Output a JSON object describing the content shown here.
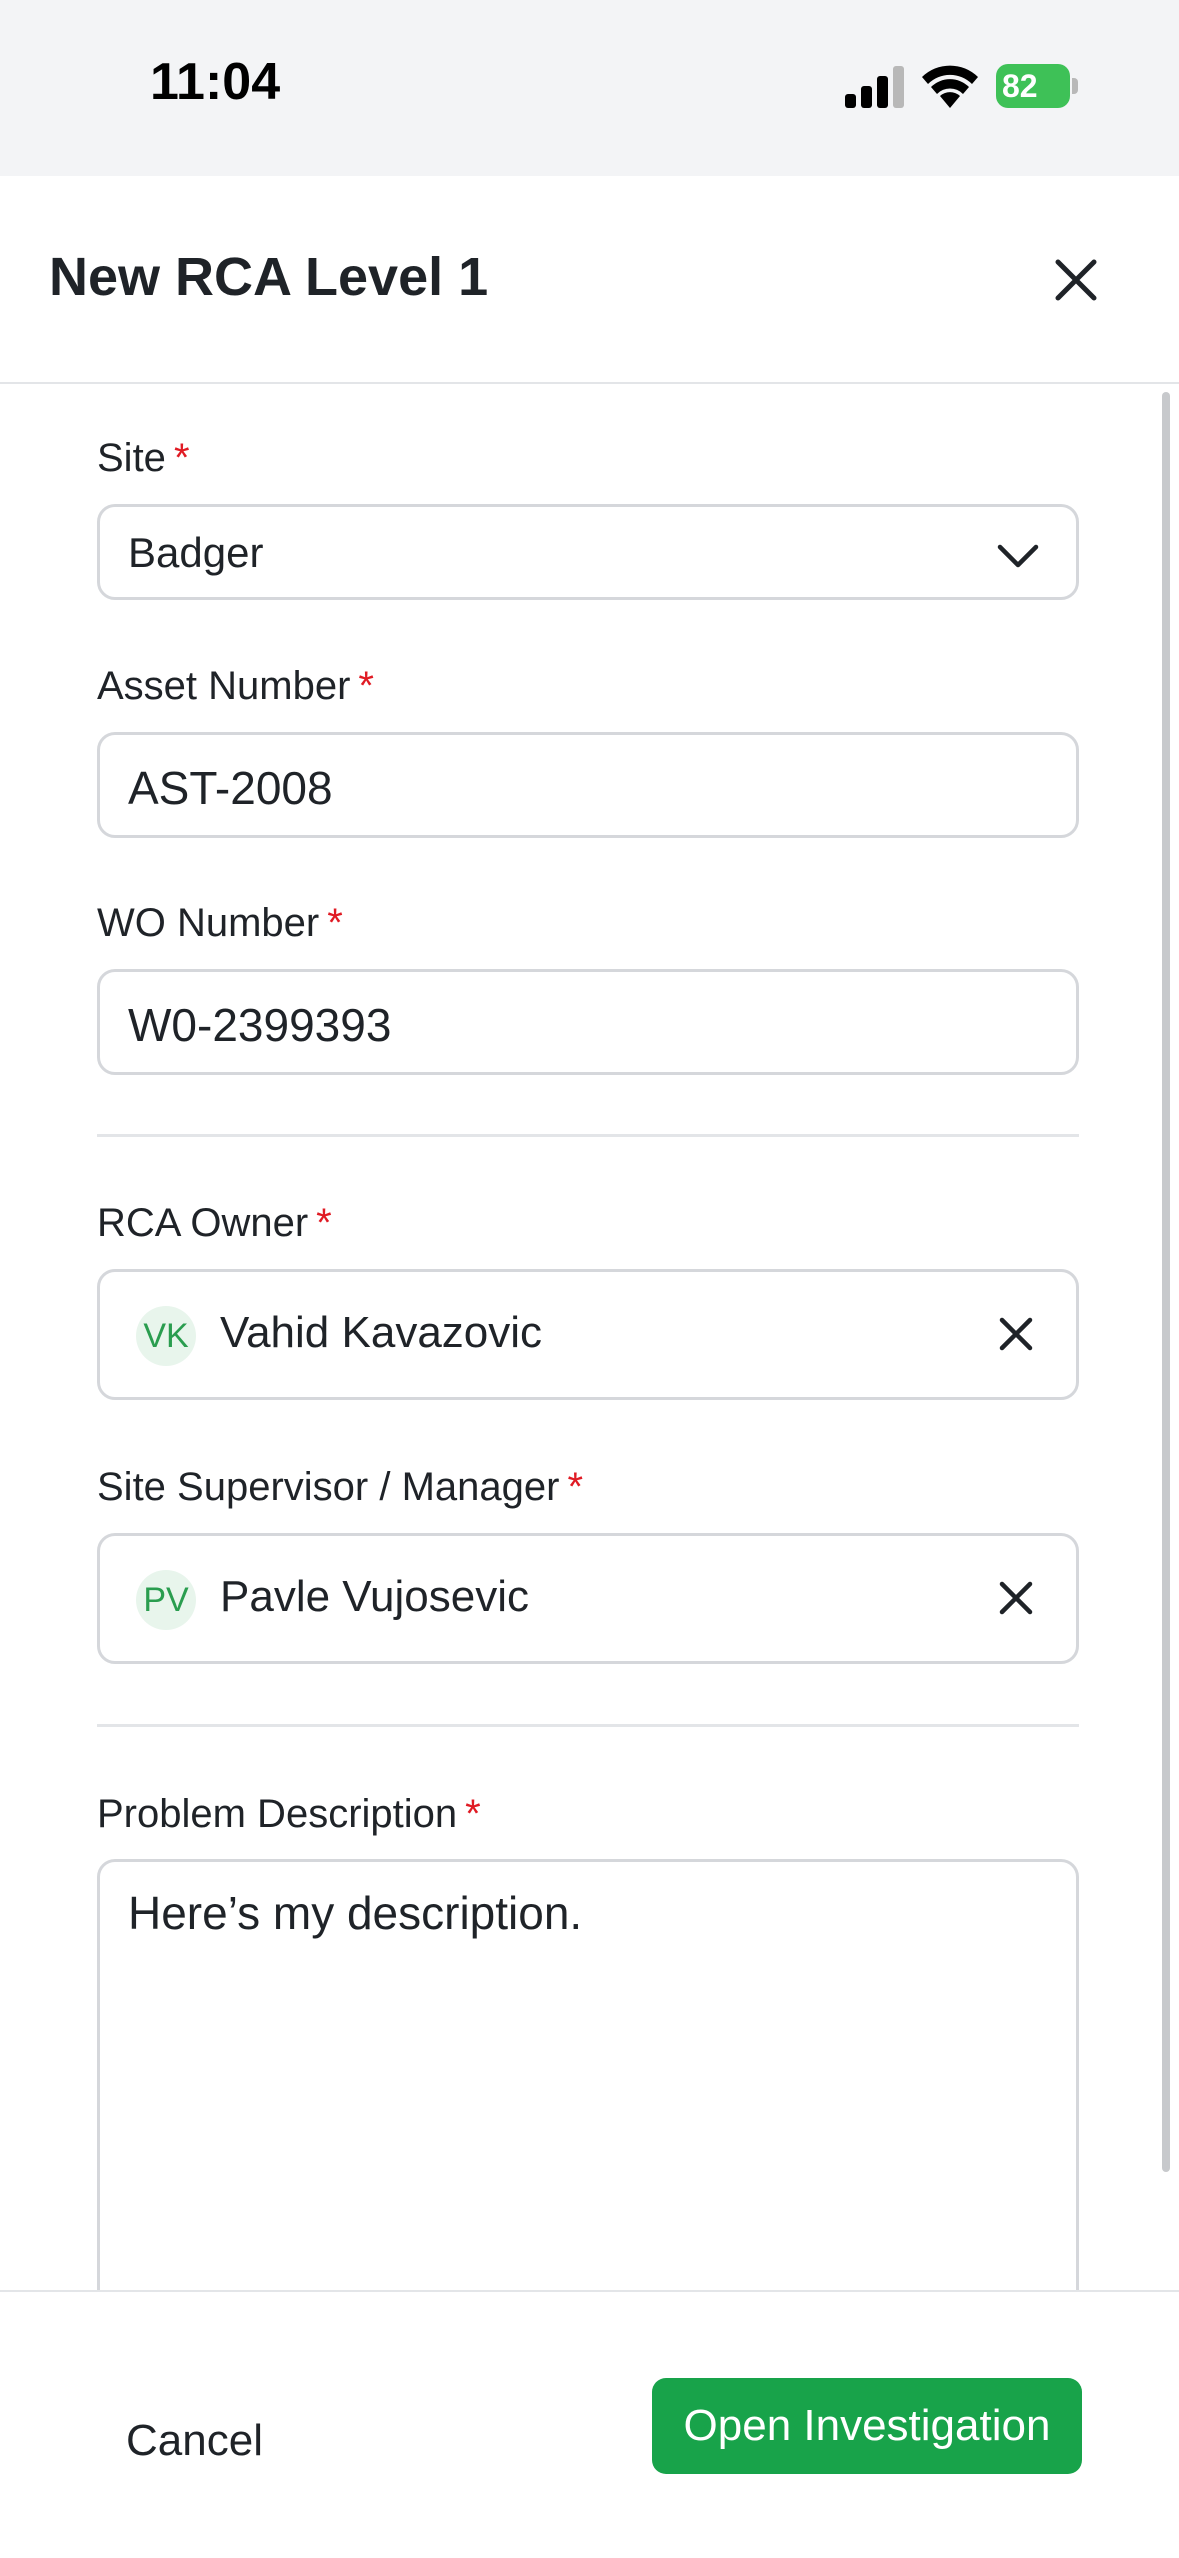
{
  "status_bar": {
    "time": "11:04",
    "battery": "82"
  },
  "header": {
    "title": "New RCA Level 1"
  },
  "form": {
    "site": {
      "label": "Site",
      "required_mark": "*",
      "value": "Badger"
    },
    "asset_number": {
      "label": "Asset Number",
      "required_mark": "*",
      "value": "AST-2008"
    },
    "wo_number": {
      "label": "WO Number",
      "required_mark": "*",
      "value": "W0-2399393"
    },
    "rca_owner": {
      "label": "RCA Owner",
      "required_mark": "*",
      "initials": "VK",
      "name": "Vahid Kavazovic"
    },
    "site_supervisor": {
      "label": "Site Supervisor / Manager",
      "required_mark": "*",
      "initials": "PV",
      "name": "Pavle Vujosevic"
    },
    "problem_description": {
      "label": "Problem Description",
      "required_mark": "*",
      "value": "Here’s my description."
    }
  },
  "footer": {
    "cancel_label": "Cancel",
    "submit_label": "Open Investigation"
  },
  "colors": {
    "accent": "#18a34a",
    "required": "#e01b24",
    "avatar_bg": "#e8f5ec",
    "avatar_text": "#2a9d4f"
  }
}
